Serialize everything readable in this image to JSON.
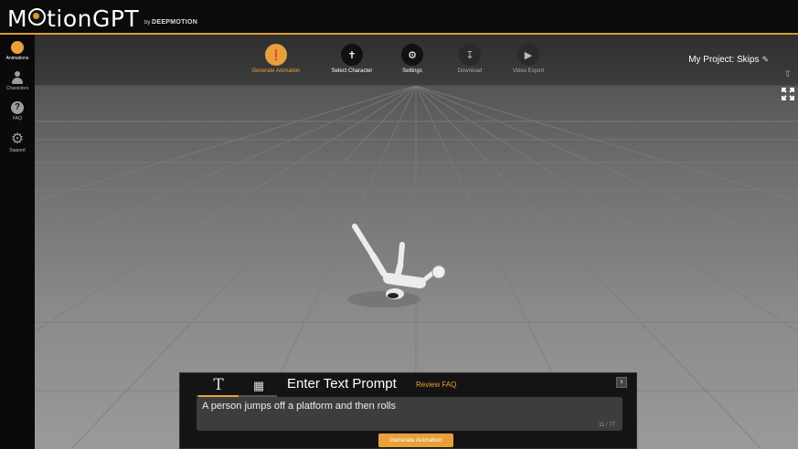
{
  "app": {
    "title_part1": "M",
    "title_part2": "tionGPT",
    "byline_by": "by",
    "byline_brand": "DEEPMOTION"
  },
  "sidebar": {
    "items": [
      {
        "label": "Animations",
        "icon": "animations-icon",
        "active": true
      },
      {
        "label": "Characters",
        "icon": "character-icon"
      },
      {
        "label": "FAQ",
        "icon": "question-icon"
      },
      {
        "label": "Support",
        "icon": "gear-icon"
      }
    ]
  },
  "toolbar": {
    "items": [
      {
        "label": "Generate Animation",
        "icon": "lightbulb-icon",
        "state": "active"
      },
      {
        "label": "Select Character",
        "icon": "character-select-icon"
      },
      {
        "label": "Settings",
        "icon": "gear-icon"
      },
      {
        "label": "Download",
        "icon": "download-icon",
        "state": "disabled"
      },
      {
        "label": "Video Export",
        "icon": "play-icon",
        "state": "disabled"
      }
    ]
  },
  "project": {
    "label": "My Project: Skips",
    "icon": "edit-icon"
  },
  "prompt": {
    "title": "Enter Text Prompt",
    "faq_link": "Review FAQ",
    "close": "x",
    "text": "A person jumps off a platform and then rolls",
    "count": "11 / 77",
    "button": "Generate Animation",
    "tabs": [
      {
        "icon": "text-icon",
        "active": true
      },
      {
        "icon": "video-icon",
        "active": false
      }
    ]
  },
  "colors": {
    "accent": "#e8a13a",
    "topbar": "#0b0b0d"
  }
}
